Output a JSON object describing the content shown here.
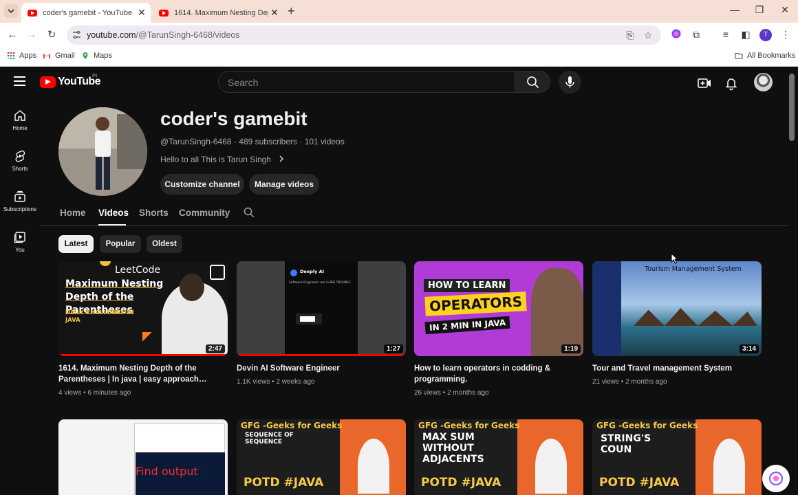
{
  "browser": {
    "tabs": [
      {
        "title": "coder's gamebit - YouTube",
        "active": true
      },
      {
        "title": "1614. Maximum Nesting Depth",
        "active": false
      }
    ],
    "url_host": "youtube.com",
    "url_path": "/@TarunSingh-6468/videos",
    "profile_letter": "T",
    "bookmarks": [
      {
        "label": "Apps",
        "icon": "apps-grid-icon"
      },
      {
        "label": "Gmail",
        "icon": "gmail-icon"
      },
      {
        "label": "Maps",
        "icon": "maps-icon"
      }
    ],
    "all_bookmarks": "All Bookmarks"
  },
  "youtube": {
    "logo_text": "YouTube",
    "country_code": "IN",
    "search_placeholder": "Search",
    "guide": [
      {
        "label": "Home",
        "icon": "home-icon"
      },
      {
        "label": "Shorts",
        "icon": "shorts-icon"
      },
      {
        "label": "Subscriptions",
        "icon": "subscriptions-icon"
      },
      {
        "label": "You",
        "icon": "you-icon"
      }
    ]
  },
  "channel": {
    "name": "coder's gamebit",
    "handle": "@TarunSingh-6468",
    "subscribers": "489 subscribers",
    "videos_count": "101 videos",
    "meta_sep": "·",
    "description": "Hello to all This is Tarun Singh",
    "customize_label": "Customize channel",
    "manage_label": "Manage videos",
    "tabs": [
      "Home",
      "Videos",
      "Shorts",
      "Community"
    ],
    "selected_tab": "Videos",
    "filters": [
      "Latest",
      "Popular",
      "Oldest"
    ],
    "selected_filter": "Latest"
  },
  "videos": [
    {
      "title": "1614. Maximum Nesting Depth of the Parentheses | In java | easy approach…",
      "views": "4 views",
      "age": "6 minutes ago",
      "duration": "2:47",
      "watched": 1.0,
      "thumb_text": {
        "brand": "LeetCode",
        "headline": "Maximum Nesting Depth of the Parentheses",
        "sub": "DAILY CHALLENGE IN JAVA"
      }
    },
    {
      "title": "Devin AI Software Engineer",
      "views": "1.1K views",
      "age": "2 weeks ago",
      "duration": "1:27",
      "watched": 1.0,
      "thumb_text": {
        "brand": "Deeply AI",
        "headline": "Software Engineers are in BIG TROUBLE"
      }
    },
    {
      "title": "How to learn operators in codding & programming.",
      "views": "26 views",
      "age": "2 months ago",
      "duration": "1:19",
      "watched": 0,
      "thumb_text": {
        "line1": "HOW TO LEARN",
        "line2": "OPERATORS",
        "line3": "IN 2 MIN IN JAVA"
      }
    },
    {
      "title": "Tour and Travel management System",
      "views": "21 views",
      "age": "2 months ago",
      "duration": "3:14",
      "watched": 0,
      "thumb_text": {
        "headline": "Tourism Management System"
      }
    }
  ],
  "second_row": [
    {
      "headline": "Find output"
    },
    {
      "brand": "GFG -Geeks for Geeks",
      "headline": "SEQUENCE OF SEQUENCE",
      "tag": "POTD #JAVA"
    },
    {
      "brand": "GFG -Geeks for Geeks",
      "headline": "MAX SUM WITHOUT ADJACENTS",
      "tag": "POTD #JAVA"
    },
    {
      "brand": "GFG -Geeks for Geeks",
      "headline": "STRING'S COUN",
      "tag": "POTD #JAVA"
    }
  ],
  "meta_dot": "•"
}
